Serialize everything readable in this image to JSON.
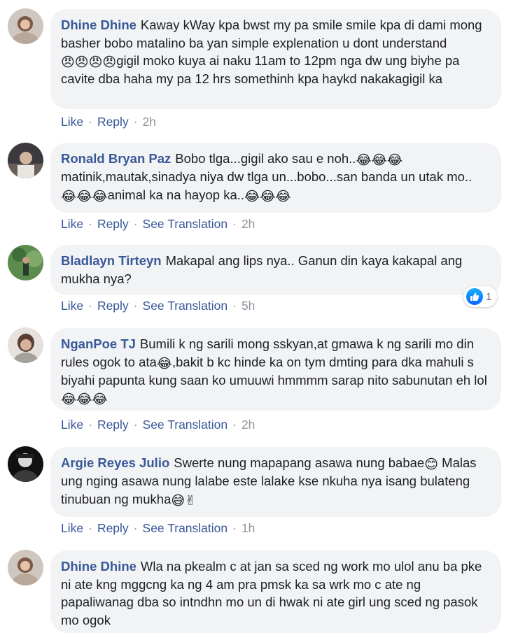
{
  "labels": {
    "like": "Like",
    "reply": "Reply",
    "see_translation": "See Translation"
  },
  "colors": {
    "link_blue": "#385898",
    "bubble_bg": "#f2f3f5",
    "meta_gray": "#90949c",
    "like_blue": "#0866ff"
  },
  "comments": [
    {
      "author": "Dhine Dhine",
      "avatar": "avatar-photo-woman",
      "text_1": "Kaway kWay kpa bwst my pa smile smile kpa di dami mong basher bobo matalino ba yan simple explenation u dont understand ",
      "emoji_1": "😠😠😠😠",
      "text_2": "gigil moko kuya ai naku 11am to 12pm nga dw ung biyhe pa cavite dba haha my pa 12 hrs somethinh kpa haykd nakakagigil ka",
      "time": "2h"
    },
    {
      "author": "Ronald Bryan Paz",
      "avatar": "avatar-photo-man",
      "text_1": "Bobo tlga...gigil ako sau e noh..",
      "emoji_1": "😂😂😂",
      "text_2": "matinik,mautak,sinadya niya dw tlga un...bobo...san banda un utak mo..",
      "emoji_2": "😂😂😂",
      "text_3": "animal ka na hayop ka..",
      "emoji_3": "😂😂😂",
      "time": "2h"
    },
    {
      "author": "Bladlayn Tirteyn",
      "avatar": "avatar-photo-outdoor",
      "text_1": "Makapal ang lips nya.. Ganun din kaya kakapal ang mukha nya?",
      "time": "5h",
      "reaction_count": "1",
      "reaction_icon": "like-thumb-icon"
    },
    {
      "author": "NganPoe TJ",
      "avatar": "avatar-photo-person",
      "text_1": "Bumili k ng sarili mong sskyan,at gmawa k ng sarili mo din rules ogok to ata",
      "emoji_1": "😂",
      "text_2": ",bakit b kc hinde ka on tym dmting para dka mahuli s biyahi papunta kung saan ko umuuwi hmmmm sarap nito sabunutan eh lol",
      "emoji_2": "😂😂😂",
      "time": "2h"
    },
    {
      "author": "Argie Reyes Julio",
      "avatar": "avatar-photo-dark",
      "text_1": "Swerte nung mapapang asawa nung babae",
      "emoji_1": "😊",
      "text_2": " Malas ung nging asawa nung lalabe este lalake kse nkuha nya isang bulateng tinubuan ng mukha",
      "emoji_2": "😅✌",
      "time": "1h"
    },
    {
      "author": "Dhine Dhine",
      "avatar": "avatar-photo-woman",
      "text_1": "Wla na pkealm c at jan sa sced ng work mo ulol anu ba pke ni ate kng mggcng ka ng 4 am pra pmsk ka sa wrk mo c ate ng papaliwanag dba so intndhn mo un di hwak ni ate girl ung sced ng pasok mo ogok"
    }
  ]
}
